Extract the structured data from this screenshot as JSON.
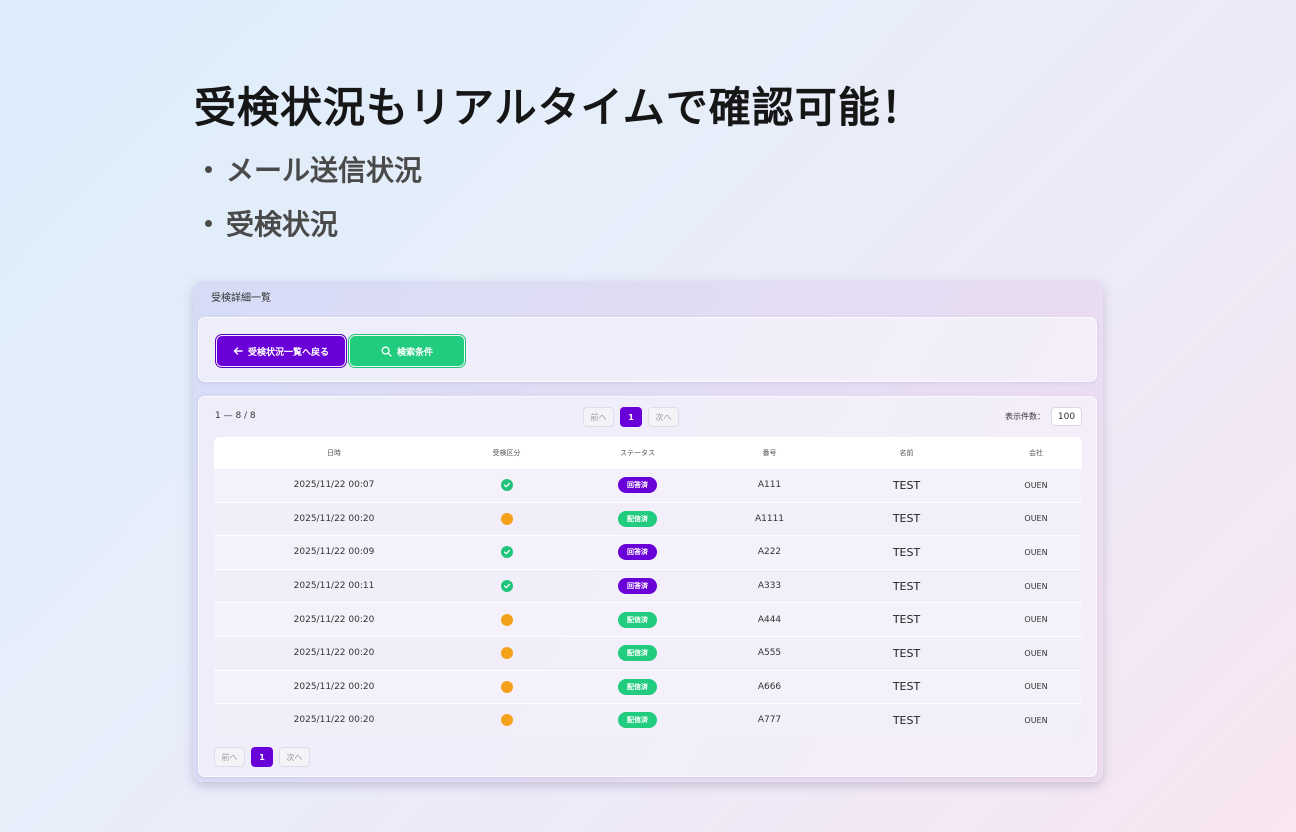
{
  "headline": "受検状況もリアルタイムで確認可能！",
  "bullets": [
    "メール送信状況",
    "受検状況"
  ],
  "panel": {
    "title": "受検詳細一覧",
    "back_button": "受検状況一覧へ戻る",
    "search_button": "検索条件",
    "count": "1 — 8 / 8",
    "pager": {
      "prev": "前へ",
      "current": "1",
      "next": "次へ"
    },
    "per_page_label": "表示件数：",
    "per_page_value": "100",
    "columns": [
      "日時",
      "受検区分",
      "ステータス",
      "番号",
      "名前",
      "会社"
    ],
    "rows": [
      {
        "datetime": "2025/11/22 00:07",
        "exam": "done",
        "status": "回答済",
        "number": "A111",
        "name": "TEST",
        "company": "OUEN"
      },
      {
        "datetime": "2025/11/22 00:20",
        "exam": "pending",
        "status": "配信済",
        "number": "A1111",
        "name": "TEST",
        "company": "OUEN"
      },
      {
        "datetime": "2025/11/22 00:09",
        "exam": "done",
        "status": "回答済",
        "number": "A222",
        "name": "TEST",
        "company": "OUEN"
      },
      {
        "datetime": "2025/11/22 00:11",
        "exam": "done",
        "status": "回答済",
        "number": "A333",
        "name": "TEST",
        "company": "OUEN"
      },
      {
        "datetime": "2025/11/22 00:20",
        "exam": "pending",
        "status": "配信済",
        "number": "A444",
        "name": "TEST",
        "company": "OUEN"
      },
      {
        "datetime": "2025/11/22 00:20",
        "exam": "pending",
        "status": "配信済",
        "number": "A555",
        "name": "TEST",
        "company": "OUEN"
      },
      {
        "datetime": "2025/11/22 00:20",
        "exam": "pending",
        "status": "配信済",
        "number": "A666",
        "name": "TEST",
        "company": "OUEN"
      },
      {
        "datetime": "2025/11/22 00:20",
        "exam": "pending",
        "status": "配信済",
        "number": "A777",
        "name": "TEST",
        "company": "OUEN"
      }
    ]
  },
  "colors": {
    "primary": "#6a00d8",
    "success": "#22cc7e",
    "pending": "#f4a11a",
    "check": "#1fc47a"
  },
  "icons": {
    "back": "arrow-left-icon",
    "search": "search-icon",
    "done": "check-circle-icon",
    "pending": "pending-dot-icon"
  }
}
